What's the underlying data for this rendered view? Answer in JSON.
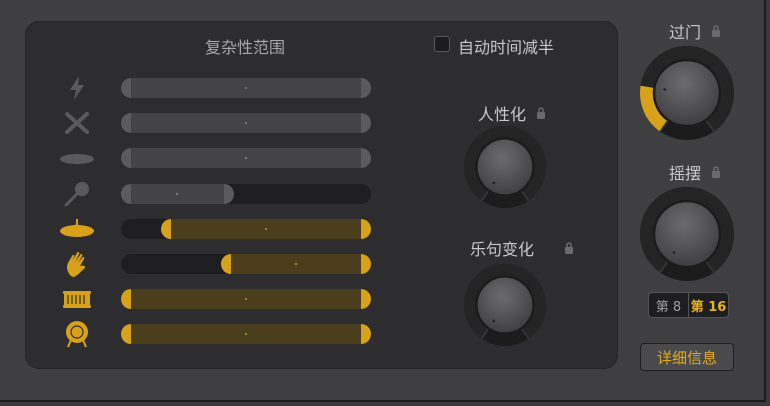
{
  "complexity": {
    "title": "复杂性范围",
    "rows": [
      {
        "icon": "lightning-icon",
        "active": false,
        "low": 0.0,
        "high": 1.0
      },
      {
        "icon": "drumsticks-icon",
        "active": false,
        "low": 0.0,
        "high": 1.0
      },
      {
        "icon": "cymbal-icon",
        "active": false,
        "low": 0.0,
        "high": 1.0
      },
      {
        "icon": "shaker-icon",
        "active": false,
        "low": 0.0,
        "high": 0.45
      },
      {
        "icon": "ride-cymbal-icon",
        "active": true,
        "low": 0.16,
        "high": 1.0
      },
      {
        "icon": "hand-clap-icon",
        "active": true,
        "low": 0.4,
        "high": 1.0
      },
      {
        "icon": "snare-drum-icon",
        "active": true,
        "low": 0.0,
        "high": 1.0
      },
      {
        "icon": "kick-drum-icon",
        "active": true,
        "low": 0.0,
        "high": 1.0
      }
    ]
  },
  "half_time": {
    "label": "自动时间减半",
    "checked": false
  },
  "humanize": {
    "label": "人性化",
    "value": 0.0
  },
  "fills": {
    "label": "乐句变化",
    "value": 0.0
  },
  "gate": {
    "label": "过门",
    "value": 0.22
  },
  "swing": {
    "label": "摇摆",
    "value": 0.0
  },
  "swing_resolution": {
    "options": [
      "第 8",
      "第 16"
    ],
    "selected": "第 16"
  },
  "details_button": {
    "label": "详细信息"
  },
  "colors": {
    "accent": "#d8a11a",
    "panel": "#2d2d2f",
    "background": "#3f3f41"
  }
}
